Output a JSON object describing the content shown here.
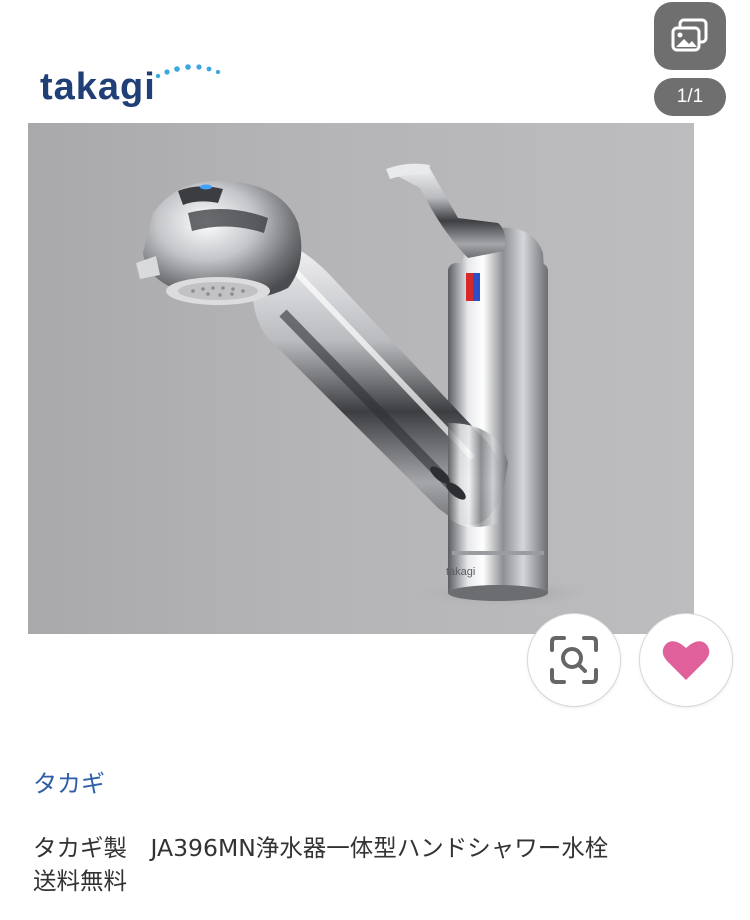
{
  "logo": {
    "text": "takagi",
    "brand_color": "#1f3f76",
    "dot_color": "#3aa7e0"
  },
  "gallery": {
    "icon": "photo-stack-icon",
    "counter": "1/1"
  },
  "product_image": {
    "watermark_text": "takagi"
  },
  "actions": {
    "zoom_icon": "zoom-search-icon",
    "favorite_icon": "heart-icon",
    "favorite_color": "#e0609a"
  },
  "brand": {
    "label": "タカギ",
    "color": "#2f5fa6"
  },
  "product": {
    "title_line1": "タカギ製　JA396MN浄水器一体型ハンドシャワー水栓",
    "title_line2": "送料無料"
  }
}
